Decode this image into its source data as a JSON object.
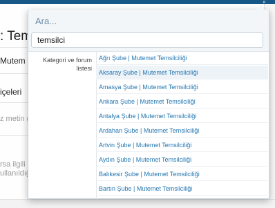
{
  "background_page": {
    "title_fragment": ": Tems",
    "field_fragment": "Mutem",
    "section_fragment": "içeleri",
    "hint_fragment": "z metin (v",
    "desc_line1": "rsa ilgili fo",
    "desc_line2": "ullanıldığı"
  },
  "search_panel": {
    "placeholder": "Ara...",
    "query": "temsilci",
    "filter_label": "Kategori ve forum listesi",
    "results": [
      "Ağrı Şube | Mutemet Temsilciliği",
      "Aksaray Şube | Mutemet Temsilciliği",
      "Amasya Şube | Mutemet Temsilciliği",
      "Ankara Şube | Mutemet Temsilciliği",
      "Antalya Şube | Mutemet Temsilciliği",
      "Ardahan Şube | Mutemet Temsilciliği",
      "Artvin Şube | Mutemet Temsilciliği",
      "Aydın Şube | Mutemet Temsilciliği",
      "Balıkesir Şube | Mutemet Temsilciliği",
      "Bartın Şube | Mutemet Temsilciliği"
    ],
    "active_index": 1
  },
  "colors": {
    "header": "#185886",
    "link": "#2577b1",
    "placeholder": "#6b8cab"
  }
}
